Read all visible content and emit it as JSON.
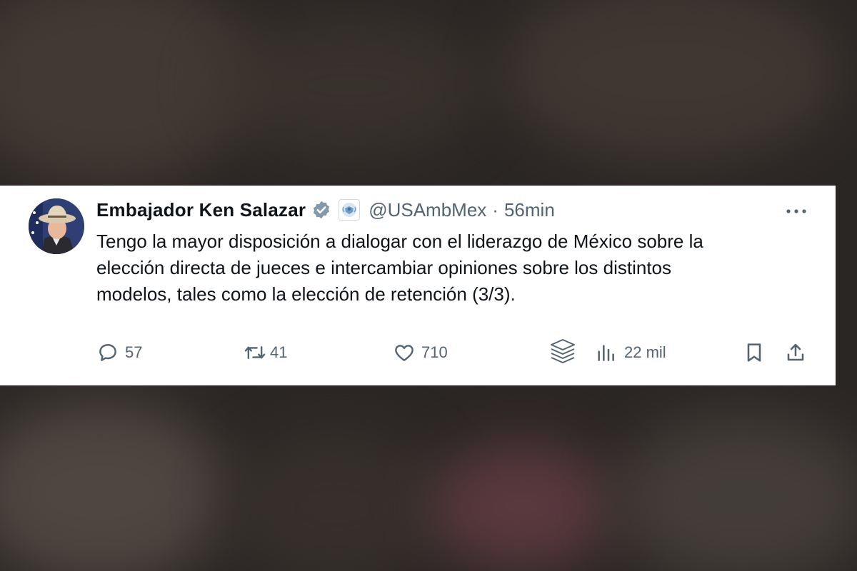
{
  "tweet": {
    "display_name": "Embajador Ken Salazar",
    "handle": "@USAmbMex",
    "separator": "·",
    "time": "56min",
    "text_lines": [
      "Tengo la mayor disposición a dialogar con el liderazgo de México sobre la",
      "elección directa de jueces e intercambiar opiniones sobre los distintos",
      "modelos, tales como la elección de retención (3/3)."
    ],
    "icons": {
      "verified": "verified-badge-icon",
      "affiliation": "government-seal-icon",
      "more": "more-options-icon"
    }
  },
  "actions": {
    "reply": {
      "icon": "reply-icon",
      "count": "57"
    },
    "retweet": {
      "icon": "retweet-icon",
      "count": "41"
    },
    "like": {
      "icon": "heart-icon",
      "count": "710"
    },
    "stack": {
      "icon": "layers-icon"
    },
    "views": {
      "icon": "analytics-icon",
      "count": "22 mil"
    },
    "bookmark": {
      "icon": "bookmark-icon"
    },
    "share": {
      "icon": "share-icon"
    }
  },
  "colors": {
    "text": "#0f1419",
    "secondary": "#536471",
    "verified": "#829aab",
    "background_dim": "#2a2624"
  }
}
